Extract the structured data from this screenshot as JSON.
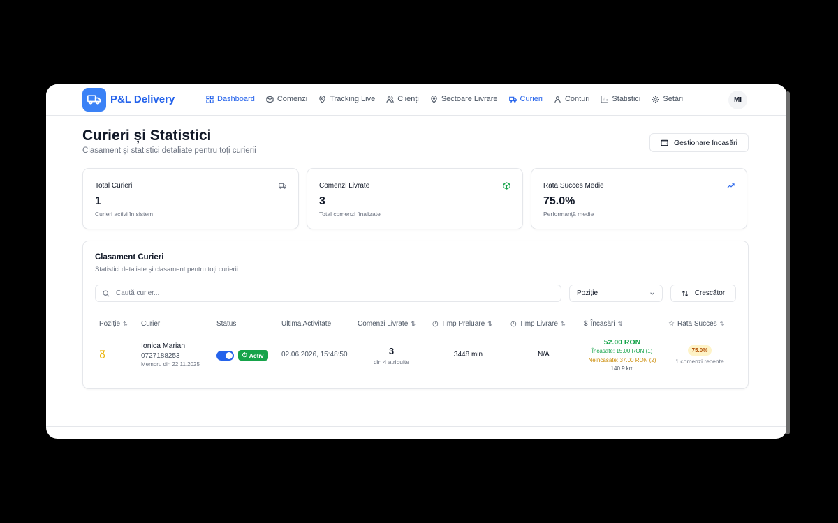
{
  "app": {
    "name": "P&L Delivery",
    "user_initials": "MI"
  },
  "nav": [
    {
      "label": "Dashboard",
      "icon": "grid-icon",
      "active": true
    },
    {
      "label": "Comenzi",
      "icon": "box-icon",
      "active": false
    },
    {
      "label": "Tracking Live",
      "icon": "pin-icon",
      "active": false
    },
    {
      "label": "Clienți",
      "icon": "users-icon",
      "active": false
    },
    {
      "label": "Sectoare Livrare",
      "icon": "pin-icon",
      "active": false
    },
    {
      "label": "Curieri",
      "icon": "truck-icon",
      "active": true
    },
    {
      "label": "Conturi",
      "icon": "user-icon",
      "active": false
    },
    {
      "label": "Statistici",
      "icon": "chart-icon",
      "active": false
    },
    {
      "label": "Setări",
      "icon": "gear-icon",
      "active": false
    }
  ],
  "page": {
    "title": "Curieri și Statistici",
    "subtitle": "Clasament și statistici detaliate pentru toți curierii",
    "action_button": "Gestionare Încasări"
  },
  "stats": [
    {
      "label": "Total Curieri",
      "value": "1",
      "desc": "Curieri activi în sistem",
      "icon": "truck-icon",
      "color": "#6b7280"
    },
    {
      "label": "Comenzi Livrate",
      "value": "3",
      "desc": "Total comenzi finalizate",
      "icon": "box-icon",
      "color": "#16a34a"
    },
    {
      "label": "Rata Succes Medie",
      "value": "75.0%",
      "desc": "Performanță medie",
      "icon": "trending-up-icon",
      "color": "#2563eb"
    }
  ],
  "ranking": {
    "title": "Clasament Curieri",
    "subtitle": "Statistici detaliate și clasament pentru toți curierii",
    "search_placeholder": "Caută curier...",
    "sort_field": "Poziție",
    "sort_order": "Crescător",
    "columns": {
      "position": "Poziție",
      "courier": "Curier",
      "status": "Status",
      "last_activity": "Ultima Activitate",
      "orders": "Comenzi Livrate",
      "pickup": "Timp Preluare",
      "delivery": "Timp Livrare",
      "income": "Încasări",
      "success": "Rata Succes"
    },
    "rows": [
      {
        "name": "Ionica Marian",
        "phone": "0727188253",
        "member_since": "Membru din 22.11.2025",
        "status": "Activ",
        "last_activity": "02.06.2026, 15:48:50",
        "orders": "3",
        "orders_sub": "din 4 atribuite",
        "pickup": "3448 min",
        "delivery": "N/A",
        "income_total": "52.00 RON",
        "income_collected": "Încasate: 15.00 RON (1)",
        "income_uncollected": "Neîncasate: 37.00 RON (2)",
        "distance": "140.9 km",
        "success_rate": "75.0%",
        "success_sub": "1 comenzi recente"
      }
    ]
  }
}
